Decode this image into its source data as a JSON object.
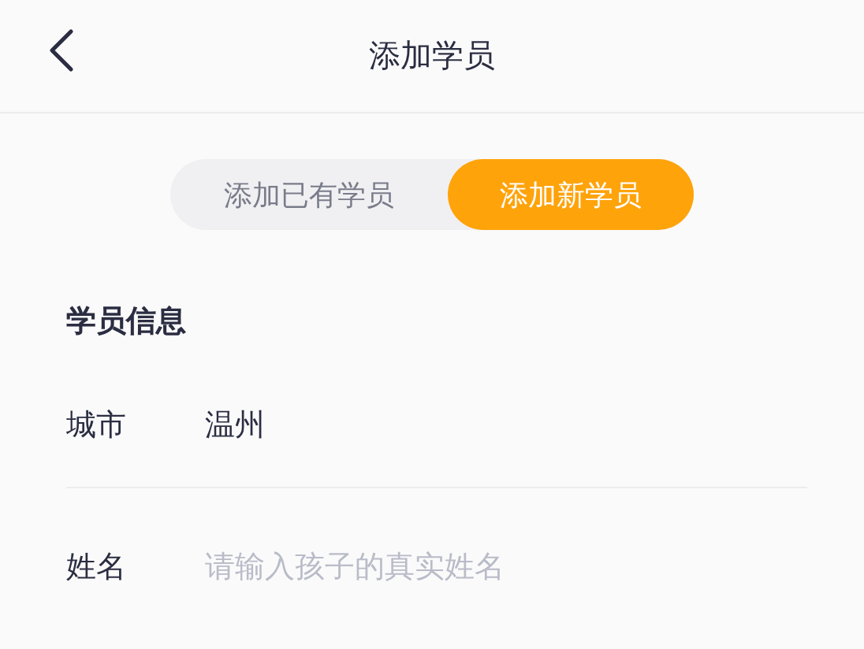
{
  "header": {
    "title": "添加学员"
  },
  "segments": [
    {
      "label": "添加已有学员",
      "selected": false
    },
    {
      "label": "添加新学员",
      "selected": true
    }
  ],
  "section": {
    "title": "学员信息"
  },
  "fields": [
    {
      "label": "城市",
      "value": "温州"
    },
    {
      "label": "姓名",
      "placeholder": "请输入孩子的真实姓名"
    }
  ]
}
